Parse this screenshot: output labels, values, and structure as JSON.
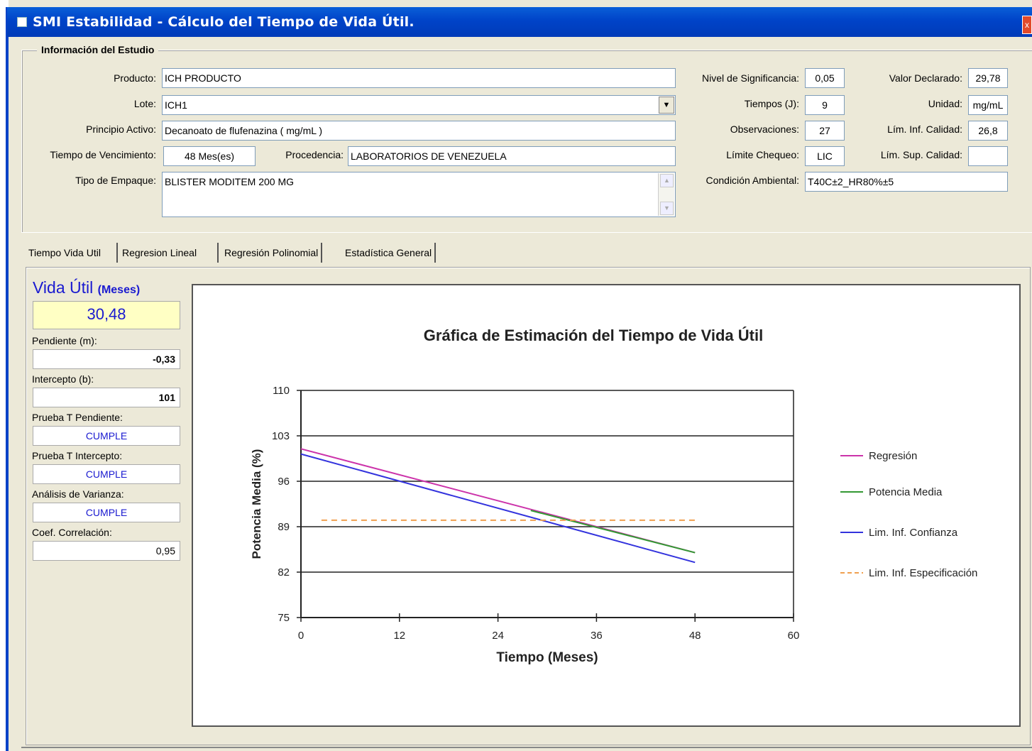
{
  "window": {
    "title": "SMI Estabilidad - Cálculo del Tiempo de Vida Útil.",
    "close_glyph": "x"
  },
  "info": {
    "section_title": "Información del Estudio",
    "producto_label": "Producto:",
    "producto": "ICH PRODUCTO",
    "lote_label": "Lote:",
    "lote": "ICH1",
    "principio_label": "Principio Activo:",
    "principio": "Decanoato de flufenazina ( mg/mL )",
    "vencimiento_label": "Tiempo de Vencimiento:",
    "vencimiento": "48 Mes(es)",
    "procedencia_label": "Procedencia:",
    "procedencia": "LABORATORIOS DE VENEZUELA",
    "empaque_label": "Tipo de Empaque:",
    "empaque": "BLISTER MODITEM 200 MG",
    "nivel_label": "Nivel de Significancia:",
    "nivel": "0,05",
    "tiempos_label": "Tiempos (J):",
    "tiempos": "9",
    "observaciones_label": "Observaciones:",
    "observaciones": "27",
    "limite_label": "Límite Chequeo:",
    "limite": "LIC",
    "condicion_label": "Condición Ambiental:",
    "condicion": "T40C±2_HR80%±5",
    "valor_label": "Valor Declarado:",
    "valor": "29,78",
    "unidad_label": "Unidad:",
    "unidad": "mg/mL",
    "liminf_label": "Lím. Inf. Calidad:",
    "liminf": "26,8",
    "limsup_label": "Lím. Sup. Calidad:",
    "limsup": ""
  },
  "tabs": [
    "Tiempo Vida Util",
    "Regresion Lineal",
    "Regresión Polinomial",
    "Estadística General"
  ],
  "side": {
    "vida_title": "Vida Útil",
    "vida_units": "(Meses)",
    "vida_value": "30,48",
    "pendiente_label": "Pendiente (m):",
    "pendiente": "-0,33",
    "intercepto_label": "Intercepto (b):",
    "intercepto": "101",
    "prueba_pend_label": "Prueba T Pendiente:",
    "prueba_pend": "CUMPLE",
    "prueba_int_label": "Prueba T Intercepto:",
    "prueba_int": "CUMPLE",
    "anova_label": "Análisis de Varianza:",
    "anova": "CUMPLE",
    "coef_label": "Coef. Correlación:",
    "coef": "0,95"
  },
  "chart_data": {
    "type": "line",
    "title": "Gráfica de Estimación del Tiempo de Vida Útil",
    "xlabel": "Tiempo (Meses)",
    "ylabel": "Potencia Media (%)",
    "xlim": [
      0,
      60
    ],
    "ylim": [
      75,
      110
    ],
    "xticks": [
      0,
      12,
      24,
      36,
      48,
      60
    ],
    "yticks": [
      75,
      82,
      89,
      96,
      103,
      110
    ],
    "grid": "horizontal",
    "legend_position": "right",
    "series": [
      {
        "name": "Regresión",
        "color": "#cc33aa",
        "dash": "",
        "x": [
          0,
          48
        ],
        "y": [
          101,
          85
        ]
      },
      {
        "name": "Potencia Media",
        "color": "#339933",
        "dash": "",
        "x": [
          28,
          48
        ],
        "y": [
          91.5,
          85
        ]
      },
      {
        "name": "Lim. Inf. Confianza",
        "color": "#3333dd",
        "dash": "",
        "x": [
          0,
          48
        ],
        "y": [
          100.2,
          83.5
        ]
      },
      {
        "name": "Lim. Inf. Especificación",
        "color": "#f0a050",
        "dash": "8 6",
        "x": [
          2.5,
          48
        ],
        "y": [
          90,
          90
        ]
      }
    ]
  }
}
